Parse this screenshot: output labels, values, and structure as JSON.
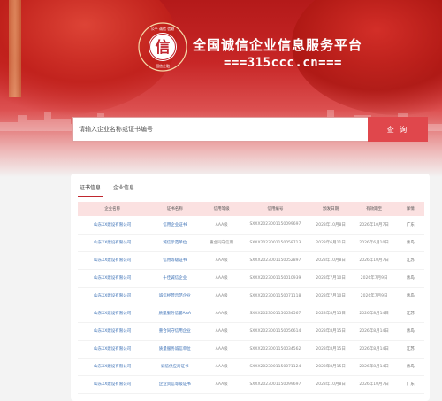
{
  "header": {
    "title": "全国诚信企业信息服务平台",
    "domain": "===315ccc.cn===",
    "logo": {
      "center_char": "信",
      "top_text": "公平 诚信 信赖",
      "bottom_text": "国信企融"
    }
  },
  "search": {
    "placeholder": "请输入企业名称或证书编号",
    "button_label": "查 询"
  },
  "tabs": [
    {
      "label": "证书信息",
      "active": true
    },
    {
      "label": "企业信息",
      "active": false
    }
  ],
  "table": {
    "columns": [
      "企业名称",
      "证书名称",
      "信用等级",
      "信用编号",
      "颁发日期",
      "有效期至",
      "详情"
    ],
    "rows": [
      [
        "山东XX建设有限公司",
        "信用企业证书",
        "AAA级",
        "SXXX2023001150099697",
        "2023年10月8日",
        "2026年10月7日",
        "广东"
      ],
      [
        "山东XX建设有限公司",
        "诚信示范单位",
        "重合同守信用",
        "SXXX2023001150058713",
        "2023年6月11日",
        "2026年6月10日",
        "青岛"
      ],
      [
        "山东XX建设有限公司",
        "信用等级证书",
        "AAA级",
        "SXXX2023001150052897",
        "2023年10月8日",
        "2026年10月7日",
        "江苏"
      ],
      [
        "山东XX建设有限公司",
        "十佳诚信企业",
        "AAA级",
        "SXXX2023001150010939",
        "2023年7月10日",
        "2026年7月9日",
        "青岛"
      ],
      [
        "山东XX建设有限公司",
        "诚信经营示范企业",
        "AAA级",
        "SXXX2023001150071118",
        "2023年7月10日",
        "2026年7月9日",
        "青岛"
      ],
      [
        "山东XX建设有限公司",
        "质量服务信誉AAA",
        "AAA级",
        "SXXX2023001150034567",
        "2023年8月15日",
        "2026年8月14日",
        "江苏"
      ],
      [
        "山东XX建设有限公司",
        "重合同守信用企业",
        "AAA级",
        "SXXX2023001150056614",
        "2023年8月15日",
        "2026年8月14日",
        "青岛"
      ],
      [
        "山东XX建设有限公司",
        "质量服务诚信单位",
        "AAA级",
        "SXXX2023001150034562",
        "2023年8月15日",
        "2026年8月14日",
        "江苏"
      ],
      [
        "山东XX建设有限公司",
        "诚信供应商证书",
        "AAA级",
        "SXXX2023001150071124",
        "2023年8月15日",
        "2026年8月14日",
        "青岛"
      ],
      [
        "山东XX建设有限公司",
        "企业资信等级证书",
        "AAA级",
        "SXXX2023001150099697",
        "2023年10月8日",
        "2026年10月7日",
        "广东"
      ]
    ]
  },
  "colors": {
    "brand_red": "#c0262e",
    "search_button": "#e0474c",
    "table_header_bg": "#fbe1e1",
    "link_blue": "#3a6fb5"
  }
}
